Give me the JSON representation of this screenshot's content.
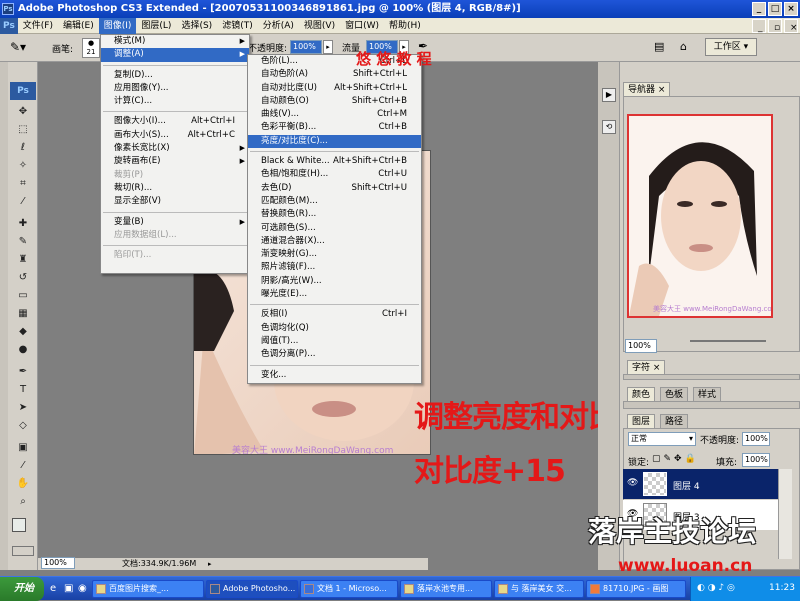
{
  "window": {
    "title": "Adobe Photoshop CS3 Extended - [20070531100346891861.jpg @ 100% (图层 4, RGB/8#)]",
    "app_icon": "Ps"
  },
  "menubar": [
    "文件(F)",
    "编辑(E)",
    "图像(I)",
    "图层(L)",
    "选择(S)",
    "滤镜(T)",
    "分析(A)",
    "视图(V)",
    "窗口(W)",
    "帮助(H)"
  ],
  "options_bar": {
    "brush_label": "画笔:",
    "brush_size": "21",
    "opacity_label": "不透明度:",
    "opacity_value": "100%",
    "flow_label": "流量",
    "flow_value": "100%",
    "workspace_label": "工作区 ▾"
  },
  "annotations": {
    "tutorial_tag": "悠 悠 教 程",
    "main_text": "调整亮度和对比度",
    "sub_text": "对比度+15",
    "doc_watermark": "美容大王 www.MeiRongDaWang.com",
    "nav_watermark": "美容大王 www.MeiRongDaWang.com",
    "bottom_right_logo": "落岸主技论坛",
    "site_url": "www.luoan.cn"
  },
  "image_menu": {
    "items": [
      {
        "label": "模式(M)",
        "submenu": true
      },
      {
        "label": "调整(A)",
        "submenu": true,
        "highlight": true
      },
      {
        "sep": true
      },
      {
        "label": "复制(D)..."
      },
      {
        "label": "应用图像(Y)..."
      },
      {
        "label": "计算(C)..."
      },
      {
        "sep": true
      },
      {
        "label": "图像大小(I)...",
        "shortcut": "Alt+Ctrl+I"
      },
      {
        "label": "画布大小(S)...",
        "shortcut": "Alt+Ctrl+C"
      },
      {
        "label": "像素长宽比(X)",
        "submenu": true
      },
      {
        "label": "旋转画布(E)",
        "submenu": true
      },
      {
        "label": "裁剪(P)",
        "disabled": true
      },
      {
        "label": "裁切(R)..."
      },
      {
        "label": "显示全部(V)"
      },
      {
        "sep": true
      },
      {
        "label": "变量(B)",
        "submenu": true
      },
      {
        "label": "应用数据组(L)...",
        "disabled": true
      },
      {
        "sep": true
      },
      {
        "label": "陷印(T)...",
        "disabled": true
      }
    ]
  },
  "adjust_menu": {
    "items": [
      {
        "label": "色阶(L)...",
        "shortcut": "Ctrl+L"
      },
      {
        "label": "自动色阶(A)",
        "shortcut": "Shift+Ctrl+L"
      },
      {
        "label": "自动对比度(U)",
        "shortcut": "Alt+Shift+Ctrl+L"
      },
      {
        "label": "自动颜色(O)",
        "shortcut": "Shift+Ctrl+B"
      },
      {
        "label": "曲线(V)...",
        "shortcut": "Ctrl+M"
      },
      {
        "label": "色彩平衡(B)...",
        "shortcut": "Ctrl+B"
      },
      {
        "label": "亮度/对比度(C)...",
        "highlight": true
      },
      {
        "sep": true
      },
      {
        "label": "Black & White...",
        "shortcut": "Alt+Shift+Ctrl+B"
      },
      {
        "label": "色相/饱和度(H)...",
        "shortcut": "Ctrl+U"
      },
      {
        "label": "去色(D)",
        "shortcut": "Shift+Ctrl+U"
      },
      {
        "label": "匹配颜色(M)..."
      },
      {
        "label": "替换颜色(R)..."
      },
      {
        "label": "可选颜色(S)..."
      },
      {
        "label": "通道混合器(X)..."
      },
      {
        "label": "渐变映射(G)..."
      },
      {
        "label": "照片滤镜(F)..."
      },
      {
        "label": "阴影/高光(W)..."
      },
      {
        "label": "曝光度(E)..."
      },
      {
        "sep": true
      },
      {
        "label": "反相(I)",
        "shortcut": "Ctrl+I"
      },
      {
        "label": "色调均化(Q)"
      },
      {
        "label": "阈值(T)..."
      },
      {
        "label": "色调分离(P)..."
      },
      {
        "sep": true
      },
      {
        "label": "变化..."
      }
    ]
  },
  "navigator": {
    "tab": "导航器",
    "zoom": "100%"
  },
  "char_panel": {
    "tab": "字符"
  },
  "color_panel": {
    "tabs": [
      "颜色",
      "色板",
      "样式"
    ]
  },
  "layers_panel": {
    "tabs": [
      "图层",
      "路径"
    ],
    "blend_mode": "正常",
    "opacity_label": "不透明度:",
    "opacity_value": "100%",
    "lock_label": "锁定:",
    "fill_label": "填充:",
    "fill_value": "100%",
    "layers": [
      {
        "name": "图层 4",
        "selected": true
      },
      {
        "name": "图层 3",
        "selected": false
      }
    ]
  },
  "statusbar": {
    "zoom": "100%",
    "doc_info": "文档:334.9K/1.96M"
  },
  "taskbar": {
    "start": "开始",
    "buttons": [
      {
        "label": "百度图片搜索_..."
      },
      {
        "label": "Adobe Photosho...",
        "active": true
      },
      {
        "label": "文档 1 - Microso..."
      },
      {
        "label": "落岸水池专用..."
      },
      {
        "label": "与 落岸美女 交..."
      },
      {
        "label": "81710.JPG - 画图"
      }
    ],
    "clock": "11:23"
  },
  "colors": {
    "accent": "#316ac5",
    "annotation_red": "#e41818",
    "title_blue": "#0a3fb8",
    "selected_layer": "#0a246a"
  }
}
